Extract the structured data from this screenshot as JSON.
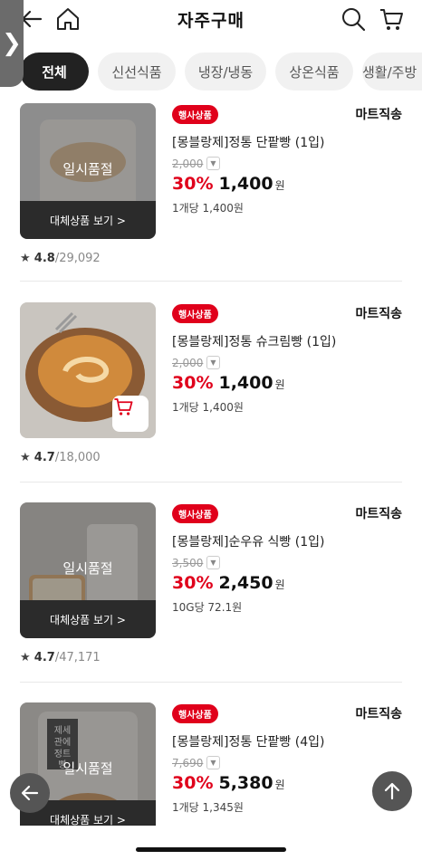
{
  "header": {
    "title": "자주구매",
    "side_handle": "❯",
    "icons": [
      "back-arrow-icon",
      "home-icon",
      "search-icon",
      "cart-icon"
    ]
  },
  "tabs": [
    {
      "label": "전체",
      "active": true
    },
    {
      "label": "신선식품",
      "active": false
    },
    {
      "label": "냉장/냉동",
      "active": false
    },
    {
      "label": "상온식품",
      "active": false
    },
    {
      "label": "생활/주방",
      "active": false
    }
  ],
  "products": [
    {
      "badge": "행사상품",
      "shipping": "마트직송",
      "name": "[몽블랑제]정통 단팥빵 (1입)",
      "original_price": "2,000",
      "discount": "30%",
      "price": "1,400",
      "currency": "원",
      "unit_price": "1개당 1,400원",
      "sold_out_label": "일시품절",
      "alt_label": "대체상품 보기 >",
      "rating": "4.8",
      "review_count": "/29,092"
    },
    {
      "badge": "행사상품",
      "shipping": "마트직송",
      "name": "[몽블랑제]정통 슈크림빵 (1입)",
      "original_price": "2,000",
      "discount": "30%",
      "price": "1,400",
      "currency": "원",
      "unit_price": "1개당 1,400원",
      "rating": "4.7",
      "review_count": "/18,000"
    },
    {
      "badge": "행사상품",
      "shipping": "마트직송",
      "name": "[몽블랑제]순우유 식빵 (1입)",
      "original_price": "3,500",
      "discount": "30%",
      "price": "2,450",
      "currency": "원",
      "unit_price": "10G당 72.1원",
      "sold_out_label": "일시품절",
      "alt_label": "대체상품 보기 >",
      "rating": "4.7",
      "review_count": "/47,171"
    },
    {
      "badge": "행사상품",
      "shipping": "마트직송",
      "name": "[몽블랑제]정통 단팥빵 (4입)",
      "original_price": "7,690",
      "discount": "30%",
      "price": "5,380",
      "currency": "원",
      "unit_price": "1개당 1,345원",
      "sold_out_label": "일시품절",
      "alt_label": "대체상품 보기 >",
      "package_text": "제세관에정트빵"
    }
  ],
  "colors": {
    "accent": "#e0001b",
    "dark": "#222222",
    "tab_bg": "#f1f1f1"
  }
}
